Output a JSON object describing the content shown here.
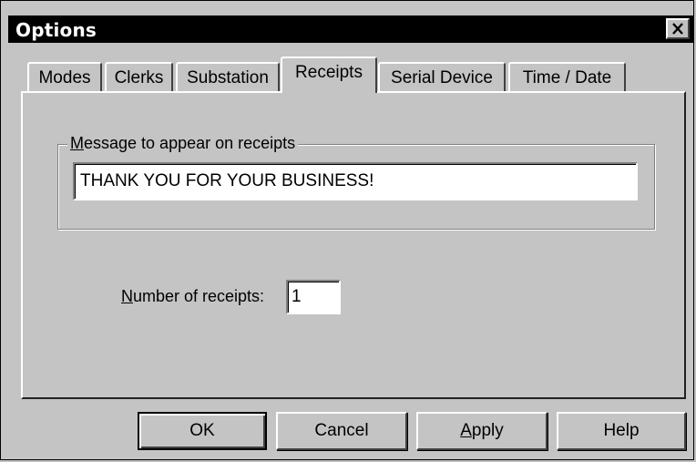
{
  "window": {
    "title": "Options",
    "close_glyph": "✕"
  },
  "tabs": [
    {
      "label": "Modes",
      "active": false
    },
    {
      "label": "Clerks",
      "active": false
    },
    {
      "label": "Substation",
      "active": false
    },
    {
      "label": "Receipts",
      "active": true
    },
    {
      "label": "Serial Device",
      "active": false
    },
    {
      "label": "Time / Date",
      "active": false
    }
  ],
  "receipts": {
    "message_group_mnemonic": "M",
    "message_group_rest": "essage to appear on receipts",
    "message_value": "THANK YOU FOR YOUR BUSINESS!",
    "number_label_mnemonic": "N",
    "number_label_rest": "umber of receipts:",
    "number_value": "1"
  },
  "buttons": {
    "ok": "OK",
    "cancel": "Cancel",
    "apply_mnemonic": "A",
    "apply_rest": "pply",
    "help": "Help"
  },
  "icons": {
    "close": "close-icon"
  }
}
